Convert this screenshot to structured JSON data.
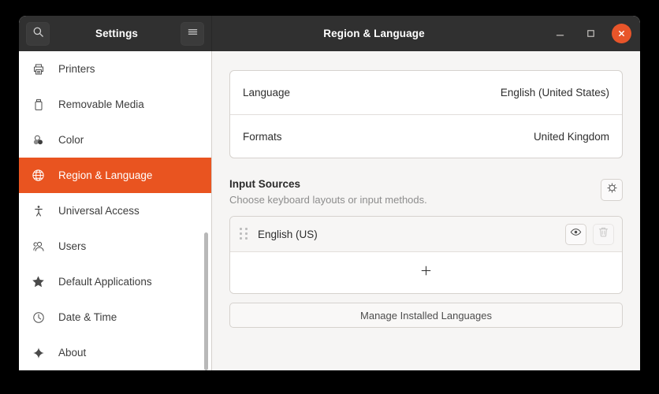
{
  "window": {
    "app_title": "Settings",
    "page_title": "Region & Language",
    "search_icon": "search-icon",
    "menu_icon": "hamburger-menu-icon",
    "minimize_label": "–",
    "maximize_label": "□",
    "close_label": "×",
    "accent_color": "#e95420",
    "titlebar_color": "#303030"
  },
  "sidebar": {
    "items": [
      {
        "label": "Printers",
        "icon": "printer-icon",
        "active": false
      },
      {
        "label": "Removable Media",
        "icon": "usb-drive-icon",
        "active": false
      },
      {
        "label": "Color",
        "icon": "color-circles-icon",
        "active": false
      },
      {
        "label": "Region & Language",
        "icon": "globe-icon",
        "active": true
      },
      {
        "label": "Universal Access",
        "icon": "accessibility-icon",
        "active": false
      },
      {
        "label": "Users",
        "icon": "users-icon",
        "active": false
      },
      {
        "label": "Default Applications",
        "icon": "star-icon",
        "active": false
      },
      {
        "label": "Date & Time",
        "icon": "clock-icon",
        "active": false
      },
      {
        "label": "About",
        "icon": "sparkle-icon",
        "active": false
      }
    ]
  },
  "main": {
    "settings_rows": [
      {
        "label": "Language",
        "value": "English (United States)"
      },
      {
        "label": "Formats",
        "value": "United Kingdom"
      }
    ],
    "input_sources": {
      "title": "Input Sources",
      "subtitle": "Choose keyboard layouts or input methods.",
      "options_icon": "gear-icon",
      "items": [
        {
          "label": "English (US)",
          "drag_icon": "drag-handle-icon",
          "preview_icon": "eye-icon",
          "remove_icon": "trash-icon"
        }
      ],
      "add_label": "+",
      "add_icon": "plus-icon"
    },
    "manage_button_label": "Manage Installed Languages"
  }
}
